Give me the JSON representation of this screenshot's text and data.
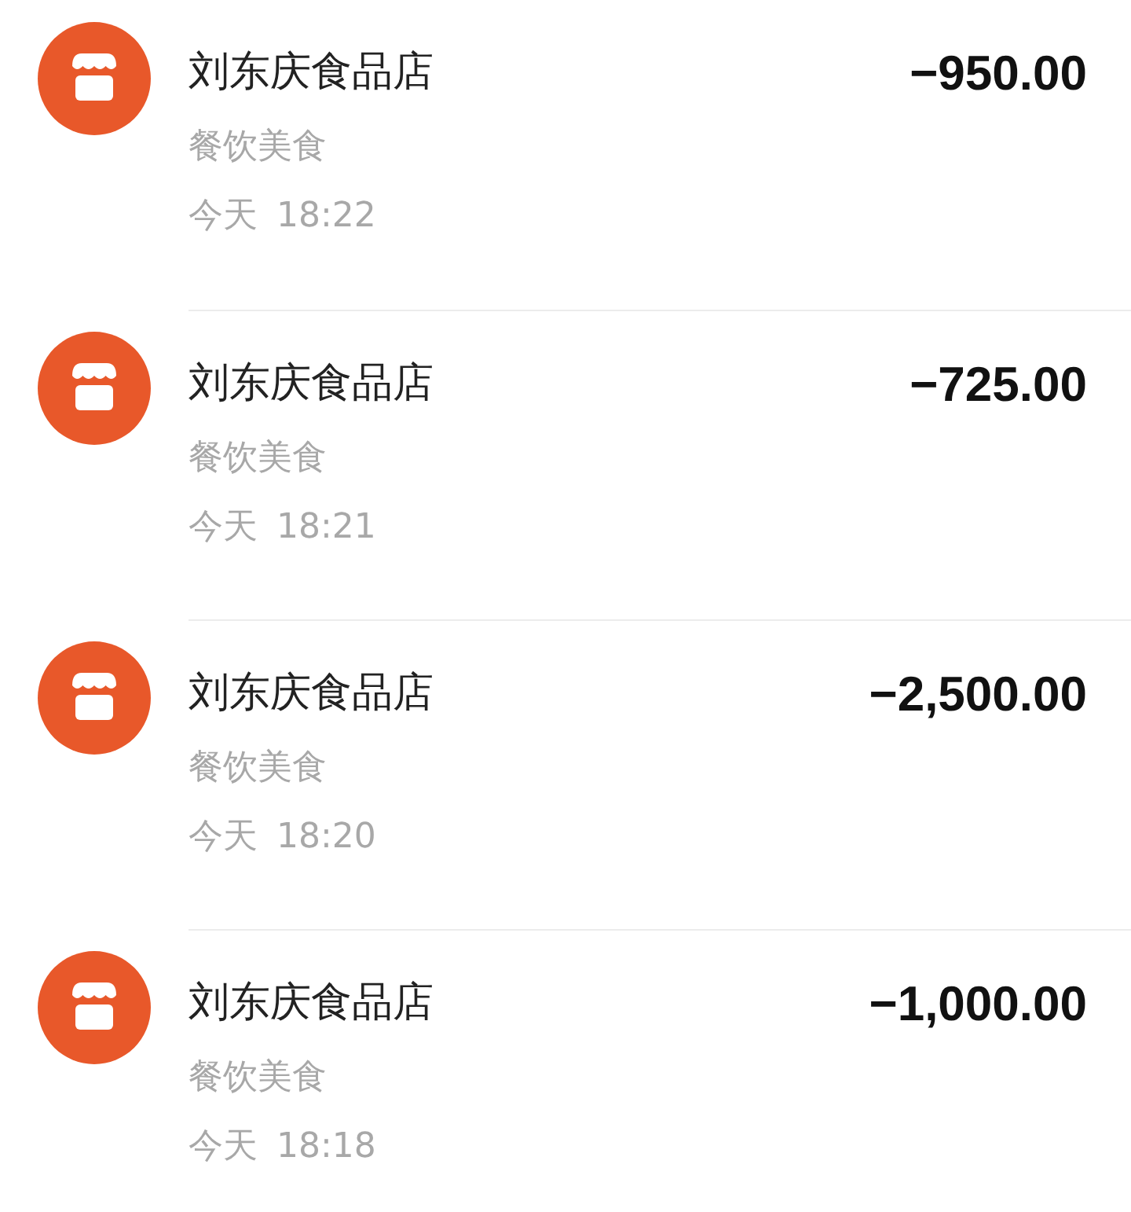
{
  "transactions": [
    {
      "merchant": "刘东庆食品店",
      "category": "餐饮美食",
      "day": "今天",
      "time": "18:22",
      "amount": "−950.00"
    },
    {
      "merchant": "刘东庆食品店",
      "category": "餐饮美食",
      "day": "今天",
      "time": "18:21",
      "amount": "−725.00"
    },
    {
      "merchant": "刘东庆食品店",
      "category": "餐饮美食",
      "day": "今天",
      "time": "18:20",
      "amount": "−2,500.00"
    },
    {
      "merchant": "刘东庆食品店",
      "category": "餐饮美食",
      "day": "今天",
      "time": "18:18",
      "amount": "−1,000.00"
    }
  ]
}
